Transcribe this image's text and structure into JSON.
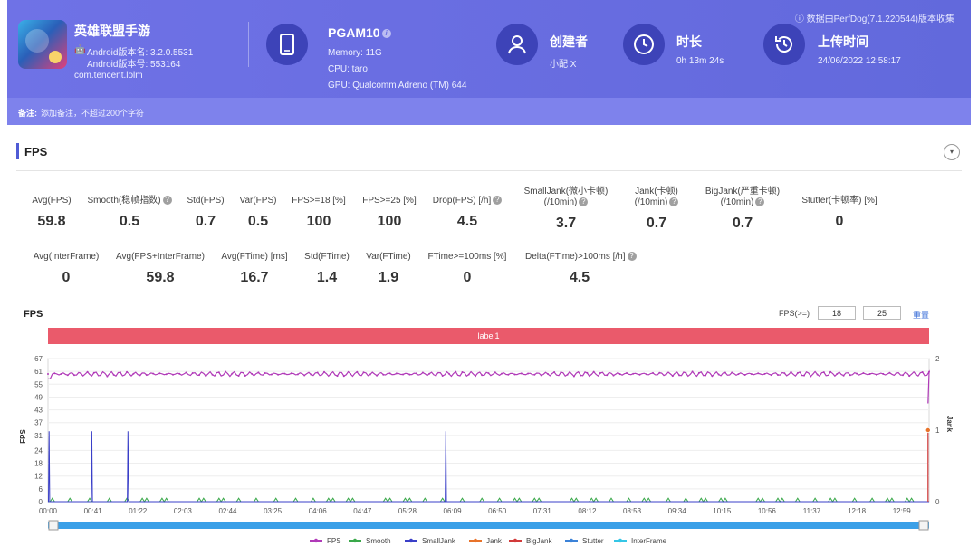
{
  "header": {
    "collect_note": "数据由PerfDog(7.1.220544)版本收集",
    "app": {
      "name": "英雄联盟手游",
      "version_name": "Android版本名: 3.2.0.5531",
      "version_code": "Android版本号: 553164",
      "package": "com.tencent.lolm"
    },
    "device": {
      "name": "PGAM10",
      "memory": "Memory: 11G",
      "cpu": "CPU: taro",
      "gpu": "GPU: Qualcomm Adreno (TM) 644"
    },
    "creator": {
      "title": "创建者",
      "value": "小配 X"
    },
    "duration": {
      "title": "时长",
      "value": "0h 13m 24s"
    },
    "upload": {
      "title": "上传时间",
      "value": "24/06/2022 12:58:17"
    }
  },
  "remark": {
    "label": "备注:",
    "placeholder": "添加备注，不超过200个字符"
  },
  "section": {
    "title": "FPS",
    "toggle": "▾"
  },
  "stats_row1": [
    {
      "label": "Avg(FPS)",
      "value": "59.8",
      "help": false
    },
    {
      "label": "Smooth(稳帧指数)",
      "value": "0.5",
      "help": true
    },
    {
      "label": "Std(FPS)",
      "value": "0.7",
      "help": false
    },
    {
      "label": "Var(FPS)",
      "value": "0.5",
      "help": false
    },
    {
      "label": "FPS>=18 [%]",
      "value": "100",
      "help": false
    },
    {
      "label": "FPS>=25 [%]",
      "value": "100",
      "help": false
    },
    {
      "label": "Drop(FPS) [/h]",
      "value": "4.5",
      "help": true
    },
    {
      "label": "SmallJank(微小卡顿)",
      "label2": "(/10min)",
      "value": "3.7",
      "help": true
    },
    {
      "label": "Jank(卡顿)",
      "label2": "(/10min)",
      "value": "0.7",
      "help": true
    },
    {
      "label": "BigJank(严重卡顿)",
      "label2": "(/10min)",
      "value": "0.7",
      "help": true
    },
    {
      "label": "Stutter(卡顿率) [%]",
      "value": "0",
      "help": false
    }
  ],
  "stats_row2": [
    {
      "label": "Avg(InterFrame)",
      "value": "0",
      "help": false
    },
    {
      "label": "Avg(FPS+InterFrame)",
      "value": "59.8",
      "help": false
    },
    {
      "label": "Avg(FTime) [ms]",
      "value": "16.7",
      "help": false
    },
    {
      "label": "Std(FTime)",
      "value": "1.4",
      "help": false
    },
    {
      "label": "Var(FTime)",
      "value": "1.9",
      "help": false
    },
    {
      "label": "FTime>=100ms [%]",
      "value": "0",
      "help": false
    },
    {
      "label": "Delta(FTime)>100ms [/h]",
      "value": "4.5",
      "help": true
    }
  ],
  "chart_controls": {
    "title": "FPS",
    "fps_ge_label": "FPS(>=)",
    "threshold_low": "18",
    "threshold_high": "25",
    "reset": "重置",
    "label_bar": "label1"
  },
  "chart_data": {
    "type": "line",
    "ylabel": "FPS",
    "y2label": "Jank",
    "ylim": [
      0,
      67
    ],
    "y_ticks": [
      "0",
      "6",
      "12",
      "18",
      "24",
      "31",
      "37",
      "43",
      "49",
      "55",
      "61",
      "67"
    ],
    "y2lim": [
      0,
      2
    ],
    "y2_ticks": [
      "0",
      "1",
      "2"
    ],
    "x_ticks": [
      "00:00",
      "00:41",
      "01:22",
      "02:03",
      "02:44",
      "03:25",
      "04:06",
      "04:47",
      "05:28",
      "06:09",
      "06:50",
      "07:31",
      "08:12",
      "08:53",
      "09:34",
      "10:15",
      "10:56",
      "11:37",
      "12:18",
      "12:59"
    ],
    "duration_s": 804,
    "series": [
      {
        "name": "FPS",
        "color": "#b03ab8",
        "base": 59.8,
        "spread": 0.7,
        "dips": [
          {
            "t": 803,
            "v": 46
          }
        ]
      },
      {
        "name": "Smooth",
        "color": "#3aa84a"
      },
      {
        "name": "SmallJank",
        "color": "#3a3fc8",
        "spikes_s": [
          1,
          40,
          73,
          363
        ],
        "spike_value": 33
      },
      {
        "name": "Jank",
        "color": "#e8732a",
        "points": [
          {
            "t": 803,
            "v": 1
          }
        ]
      },
      {
        "name": "BigJank",
        "color": "#d23a3a",
        "points": [
          {
            "t": 803,
            "v": 1
          }
        ]
      },
      {
        "name": "Stutter",
        "color": "#3b82d8"
      },
      {
        "name": "InterFrame",
        "color": "#35c6e6"
      }
    ]
  }
}
